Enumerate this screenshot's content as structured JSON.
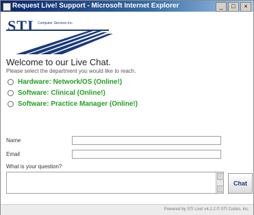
{
  "window": {
    "title": "Request Live! Support - Microsoft Internet Explorer",
    "minimize_label": "_",
    "maximize_label": "□",
    "close_label": "×"
  },
  "logo": {
    "text": "STI",
    "subtitle": "Computer Services Inc."
  },
  "welcome": {
    "heading": "Welcome to our Live Chat.",
    "instructions": "Please select the department you would like to reach."
  },
  "departments": [
    {
      "label": "Hardware: Network/OS (Online!)"
    },
    {
      "label": "Software: Clinical (Online!)"
    },
    {
      "label": "Software: Practice Manager (Online!)"
    }
  ],
  "form": {
    "name_label": "Name",
    "email_label": "Email",
    "name_value": "",
    "email_value": "",
    "question_label": "What is your question?",
    "chat_button": "Chat"
  },
  "footer": {
    "text": "Powered by STI Live! v4.2.2 © STI Codes, Inc."
  },
  "colors": {
    "online": "#22a022",
    "brand": "#1a3a7a"
  }
}
